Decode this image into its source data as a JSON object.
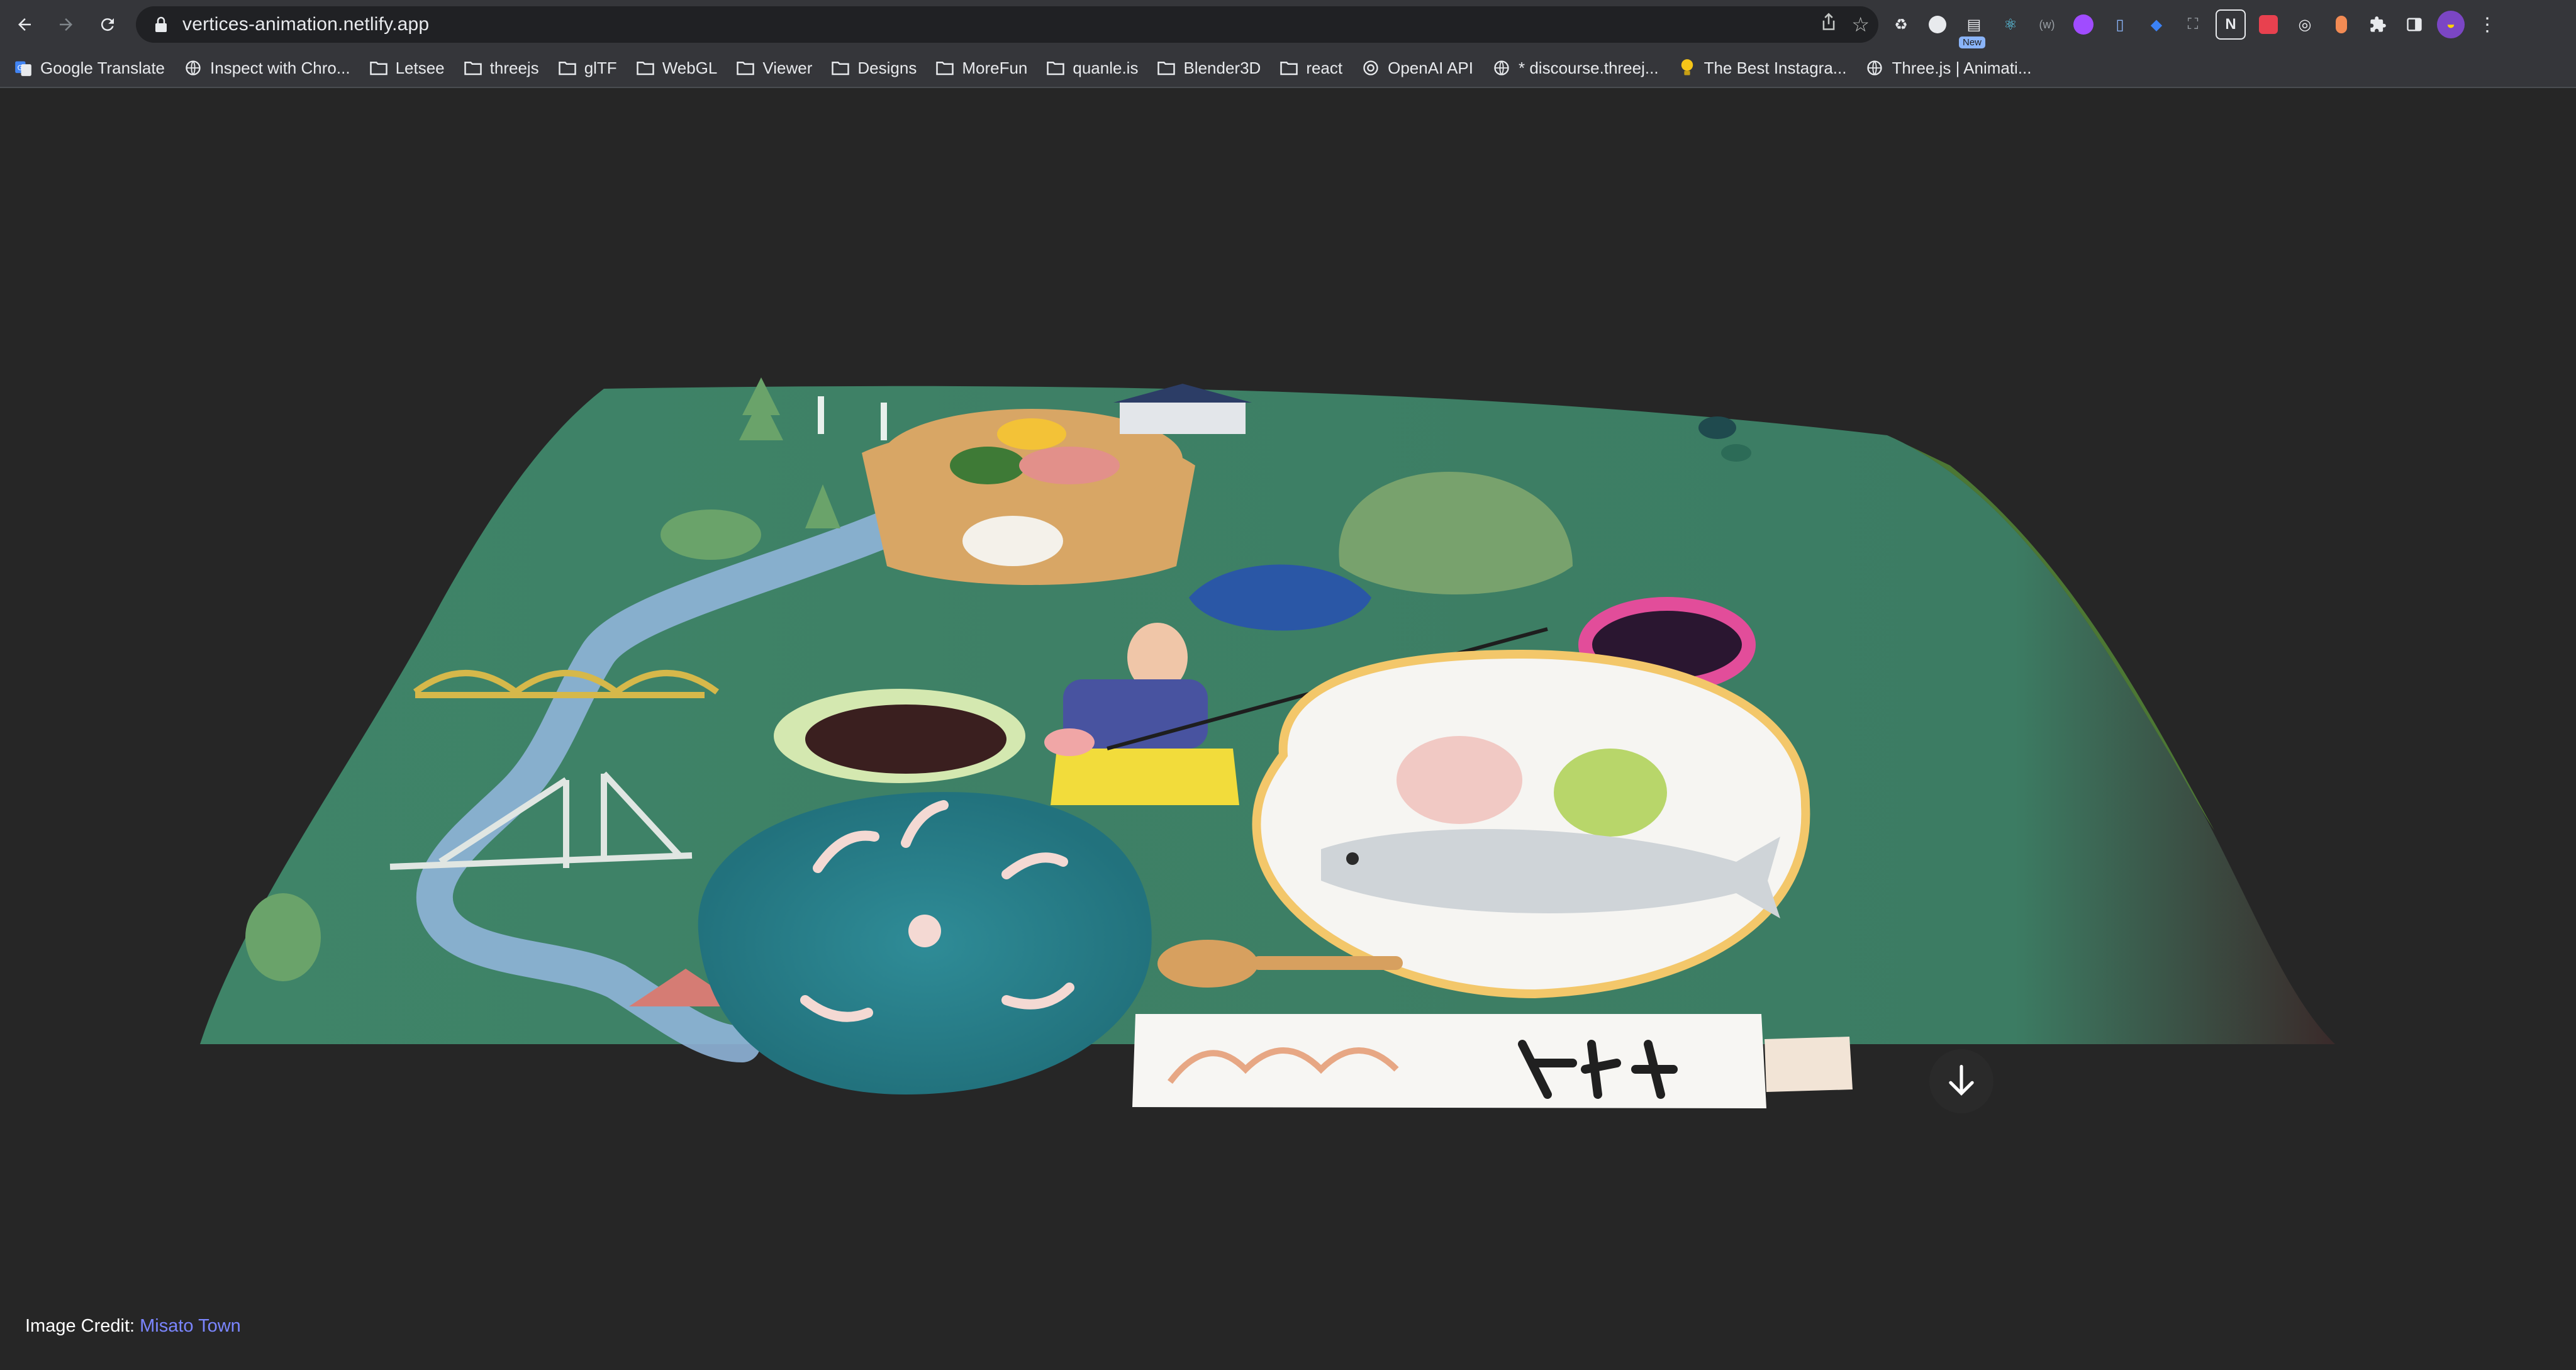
{
  "browser": {
    "url": "vertices-animation.netlify.app",
    "extension_badge": "New",
    "bookmarks": [
      {
        "label": "Google Translate",
        "icon": "google-translate-icon"
      },
      {
        "label": "Inspect with Chro...",
        "icon": "globe-icon"
      },
      {
        "label": "Letsee",
        "icon": "folder-icon"
      },
      {
        "label": "threejs",
        "icon": "folder-icon"
      },
      {
        "label": "glTF",
        "icon": "folder-icon"
      },
      {
        "label": "WebGL",
        "icon": "folder-icon"
      },
      {
        "label": "Viewer",
        "icon": "folder-icon"
      },
      {
        "label": "Designs",
        "icon": "folder-icon"
      },
      {
        "label": "MoreFun",
        "icon": "folder-icon"
      },
      {
        "label": "quanle.is",
        "icon": "folder-icon"
      },
      {
        "label": "Blender3D",
        "icon": "folder-icon"
      },
      {
        "label": "react",
        "icon": "folder-icon"
      },
      {
        "label": "OpenAI API",
        "icon": "openai-icon"
      },
      {
        "label": "* discourse.threej...",
        "icon": "globe-icon"
      },
      {
        "label": "The Best Instagra...",
        "icon": "lightbulb-icon"
      },
      {
        "label": "Three.js | Animati...",
        "icon": "globe-icon"
      }
    ]
  },
  "page": {
    "credit_prefix": "Image Credit: ",
    "credit_link": "Misato Town",
    "colors": {
      "background": "#262626",
      "plane_green": "#3f8468",
      "link": "#7b86ff"
    }
  }
}
